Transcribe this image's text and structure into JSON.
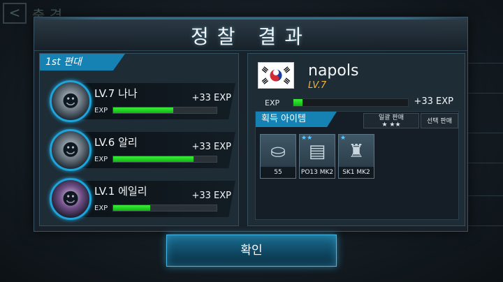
{
  "background": {
    "back_glyph": "<",
    "title": "출 격"
  },
  "modal": {
    "title": "정찰 결과"
  },
  "squad": {
    "header": "1st 편대",
    "exp_label": "EXP",
    "members": [
      {
        "level_name": "LV.7 나나",
        "gain": "+33 EXP",
        "exp_fraction": 0.58
      },
      {
        "level_name": "LV.6 알리",
        "gain": "+33 EXP",
        "exp_fraction": 0.78
      },
      {
        "level_name": "LV.1 에일리",
        "gain": "+33 EXP",
        "exp_fraction": 0.36
      }
    ]
  },
  "player": {
    "name": "napols",
    "level": "LV.7",
    "exp_label": "EXP",
    "exp_fraction": 0.08,
    "gain": "+33 EXP",
    "flag": "south-korea-flag"
  },
  "items": {
    "header": "획득 아이템",
    "bulk_sell": "일괄 판매",
    "bulk_sell_stars": "★ ★★",
    "select_sell": "선택 판매",
    "list": [
      {
        "stars": "",
        "label": "55",
        "icon": "coins-icon"
      },
      {
        "stars": "★★",
        "label": "PO13 MK2",
        "icon": "document-icon"
      },
      {
        "stars": "★",
        "label": "SK1 MK2",
        "icon": "robot-part-icon"
      }
    ]
  },
  "confirm_label": "확인",
  "colors": {
    "accent": "#1682b4",
    "exp_green": "#2ad82a",
    "level_gold": "#f1b43a"
  }
}
